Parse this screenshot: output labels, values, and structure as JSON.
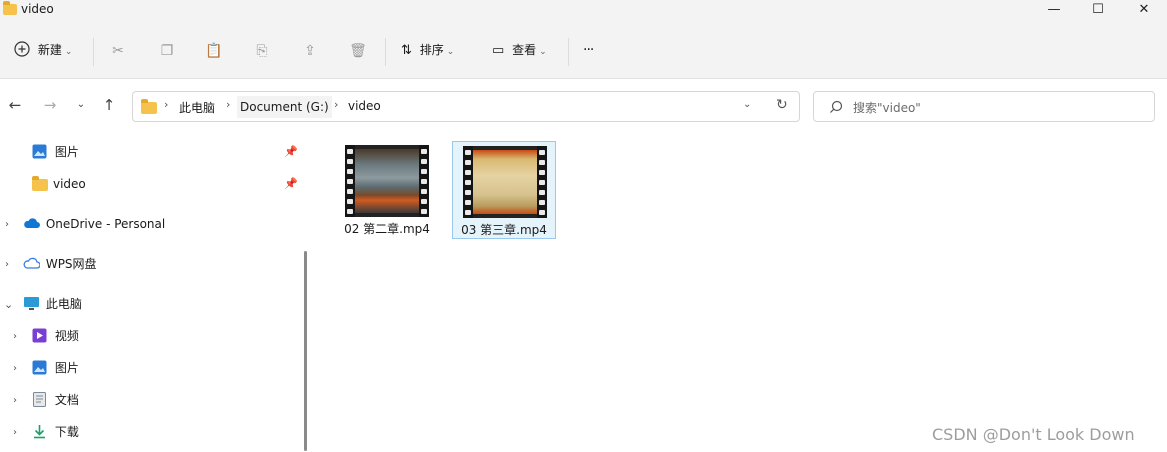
{
  "window": {
    "title": "video",
    "minimize": "—",
    "maximize": "☐",
    "close": "✕"
  },
  "toolbar": {
    "new_label": "新建",
    "sort_label": "排序",
    "view_label": "查看",
    "more_label": "···",
    "icons": [
      "cut-icon",
      "copy-icon",
      "paste-icon",
      "rename-icon",
      "share-icon",
      "delete-icon"
    ]
  },
  "address": {
    "breadcrumbs": [
      "此电脑",
      "Document (G:)",
      "video"
    ],
    "search_placeholder": "搜索\"video\""
  },
  "nav": {
    "quick": [
      {
        "label": "图片"
      },
      {
        "label": "video"
      }
    ],
    "onedrive": "OneDrive - Personal",
    "wps": "WPS网盘",
    "this_pc": "此电脑",
    "pc_items": [
      {
        "label": "视频"
      },
      {
        "label": "图片"
      },
      {
        "label": "文档"
      },
      {
        "label": "下载"
      }
    ]
  },
  "files": [
    {
      "name": "02 第二章.mp4",
      "selected": false
    },
    {
      "name": "03 第三章.mp4",
      "selected": true
    }
  ],
  "watermark": "CSDN @Don't Look Down"
}
